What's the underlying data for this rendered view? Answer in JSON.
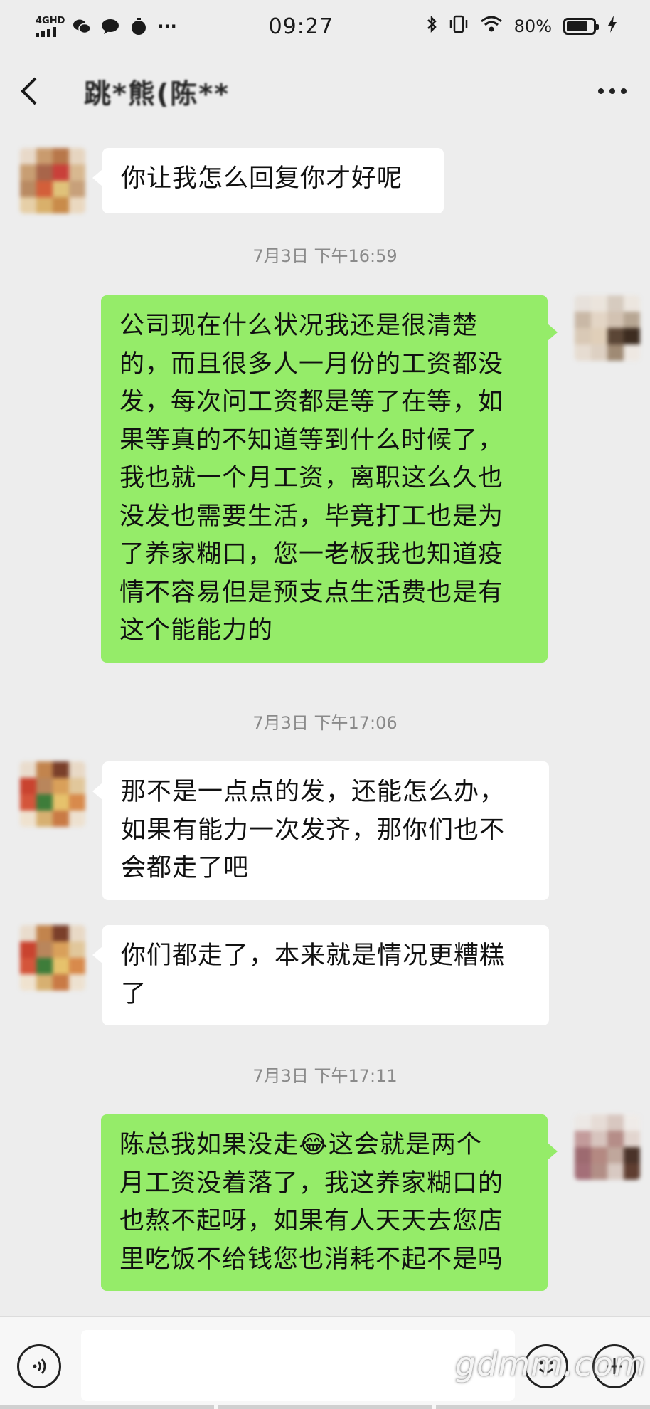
{
  "status_bar": {
    "network": "4GHD",
    "time": "09:27",
    "battery": "80%",
    "battery_level": 0.8
  },
  "header": {
    "title": "跳*熊(陈**",
    "more_icon": "more-dots-icon",
    "back_icon": "chevron-left-icon"
  },
  "messages": [
    {
      "sender": "other",
      "text": "你让我怎么回复你才好呢"
    },
    {
      "timestamp": "7月3日 下午16:59"
    },
    {
      "sender": "me",
      "lines": [
        "公司现在什么状况我还是很清楚",
        "的，而且很多人一月份的工资都没",
        "发，每次问工资都是等了在等，如",
        "果等真的不知道等到什么时候了，",
        "我也就一个月工资，离职这么久也",
        "没发也需要生活，毕竟打工也是为",
        "了养家糊口，您一老板我也知道疫",
        "情不容易但是预支点生活费也是有",
        "这个能能力的"
      ]
    },
    {
      "timestamp": "7月3日 下午17:06"
    },
    {
      "sender": "other",
      "lines": [
        "那不是一点点的发，还能怎么办，",
        "如果有能力一次发齐，那你们也不",
        "会都走了吧"
      ]
    },
    {
      "sender": "other",
      "lines": [
        "你们都走了，本来就是情况更糟糕",
        "了"
      ]
    },
    {
      "timestamp": "7月3日 下午17:11"
    },
    {
      "sender": "me",
      "lines": [
        "陈总我如果没走😂这会就是两个",
        "月工资没着落了，我这养家糊口的",
        "也熬不起呀，如果有人天天去您店",
        "里吃饭不给钱您也消耗不起不是吗"
      ]
    }
  ],
  "input_bar": {
    "voice_icon": "voice-icon",
    "emoji_icon": "emoji-icon",
    "plus_icon": "plus-icon",
    "input_value": ""
  },
  "watermark": "gdmm.com"
}
